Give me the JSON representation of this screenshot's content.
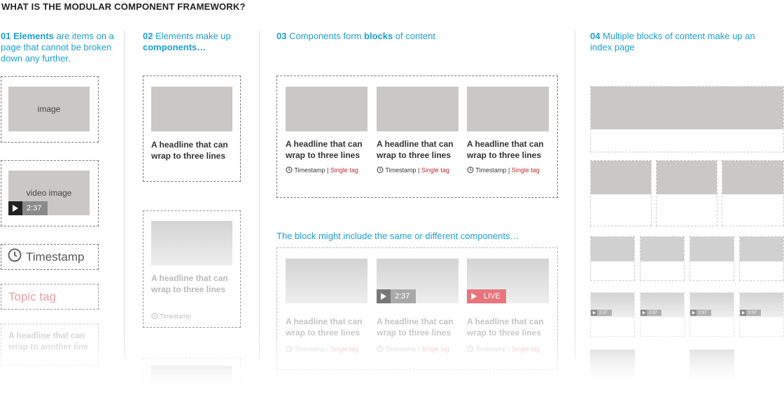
{
  "title": "WHAT IS THE MODULAR COMPONENT FRAMEWORK?",
  "col1": {
    "num": "01",
    "bold": "Elements",
    "rest": " are items on a page that cannot be broken down any further.",
    "image_label": "image",
    "video_label": "video image",
    "duration": "2:37",
    "timestamp": "Timestamp",
    "topic_tag": "Topic tag",
    "headline": "A headline that can wrap to another line"
  },
  "col2": {
    "num": "02",
    "pre": "Elements make up ",
    "bold": "components…",
    "headline": "A headline that can wrap to three lines",
    "timestamp": "Timestamp"
  },
  "col3": {
    "num": "03",
    "pre": "Components form ",
    "bold": "blocks",
    "post": " of content",
    "headline": "A headline that can wrap to three lines",
    "timestamp": "Timestamp",
    "single_tag": "Single tag",
    "subhead": "The block might include the same or different components…",
    "duration": "2:37",
    "live": "LIVE"
  },
  "col4": {
    "num": "04",
    "text": "Multiple blocks of content make up an index page",
    "duration": "2:37"
  },
  "colors": {
    "accent": "#1a9fd6",
    "tag": "#c0242b",
    "live": "#e8757d",
    "placeholder": "#c9c8c7"
  },
  "icons": [
    "clock-icon",
    "play-icon"
  ]
}
